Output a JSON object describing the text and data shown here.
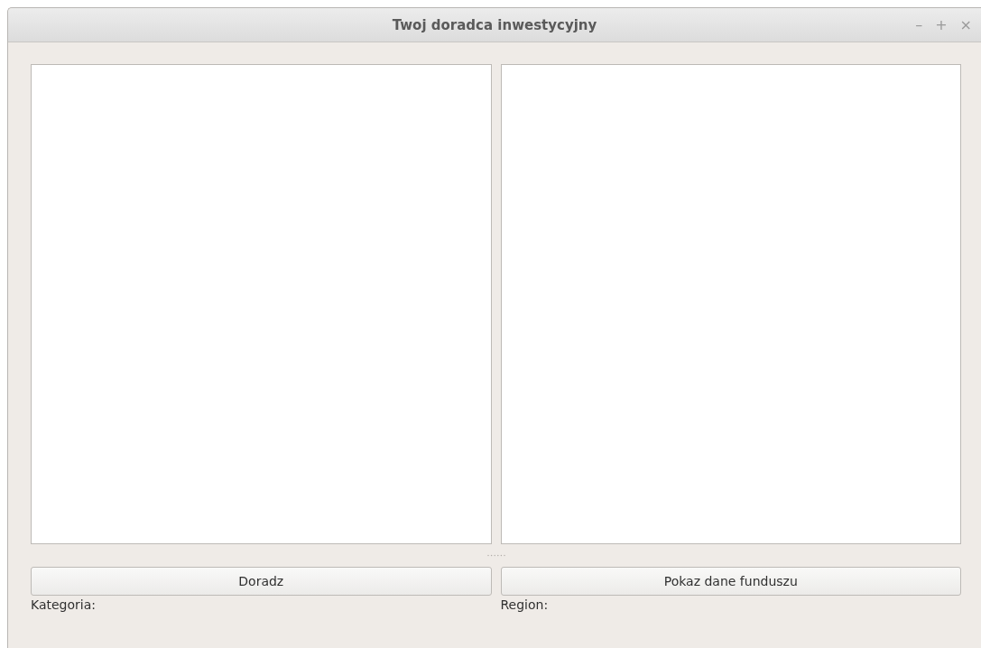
{
  "window": {
    "title": "Twoj doradca inwestycyjny",
    "controls": [
      "–",
      "+",
      "×"
    ]
  },
  "columns": [
    {
      "button": "Doradz",
      "label": "Kategoria:"
    },
    {
      "button": "Pokaz dane funduszu",
      "label": "Region:"
    }
  ]
}
